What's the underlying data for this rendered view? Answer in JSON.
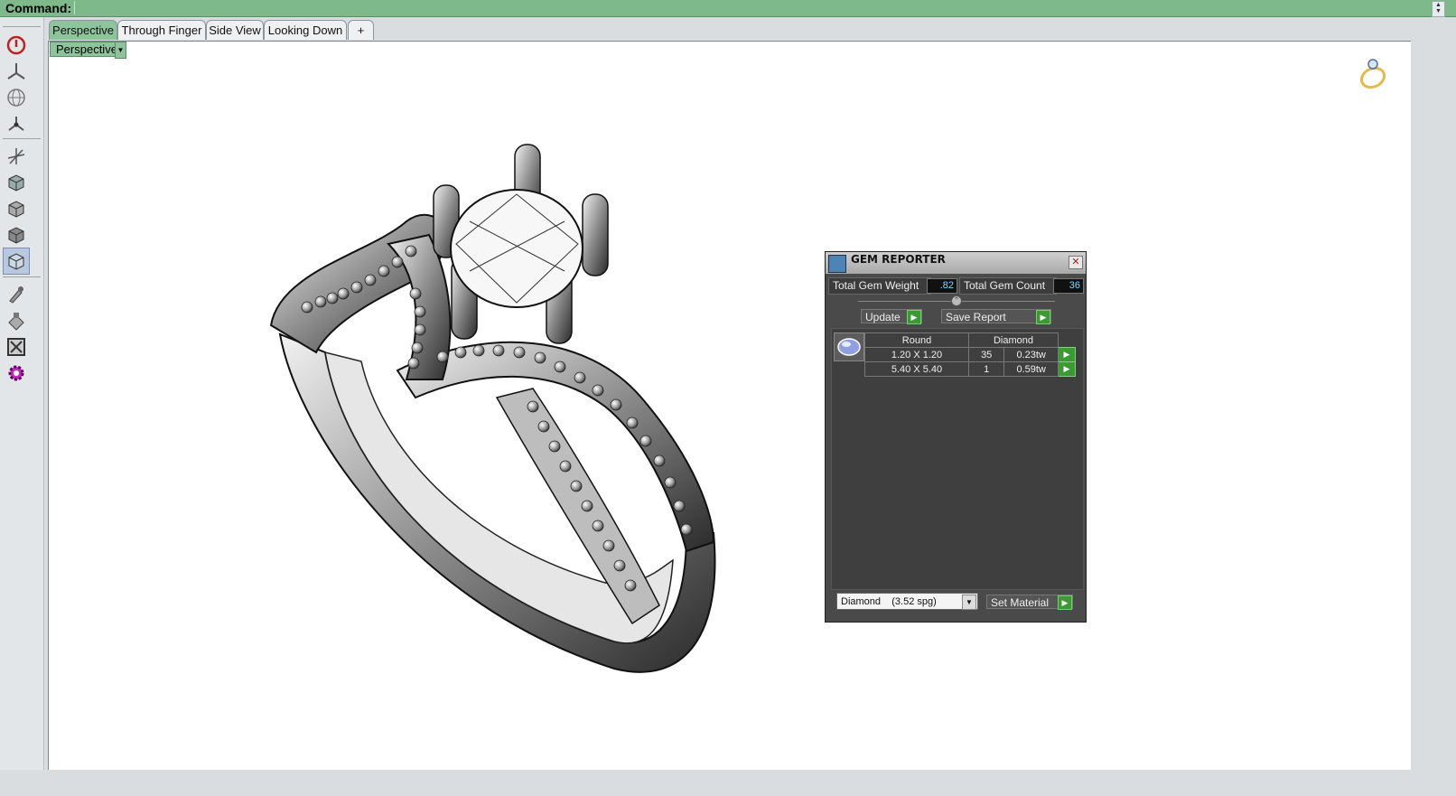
{
  "command_bar": {
    "label": "Command:",
    "value": ""
  },
  "tabs": [
    {
      "label": "Perspective"
    },
    {
      "label": "Through Finger"
    },
    {
      "label": "Side View"
    },
    {
      "label": "Looking Down"
    },
    {
      "label": "+"
    }
  ],
  "viewport": {
    "label": "Perspective"
  },
  "toolbar": {
    "icons": [
      "power-icon",
      "axes-icon",
      "sphere-icon",
      "node-icon",
      "move-icon",
      "cube-icon",
      "cube-icon",
      "cube-icon",
      "cube-icon",
      "brush-icon",
      "paint-icon",
      "frame-icon",
      "gear-icon"
    ]
  },
  "gem_reporter": {
    "title": "GEM REPORTER",
    "total_weight_label": "Total Gem Weight",
    "total_weight_value": ".82",
    "total_count_label": "Total Gem Count",
    "total_count_value": "36",
    "update_label": "Update",
    "save_label": "Save Report",
    "table": {
      "headers": [
        "Round",
        "Diamond"
      ],
      "rows": [
        {
          "size": "1.20 X 1.20",
          "count": "35",
          "weight": "0.23tw"
        },
        {
          "size": "5.40 X 5.40",
          "count": "1",
          "weight": "0.59tw"
        }
      ]
    },
    "material_select": "Diamond    (3.52 spg)",
    "set_material_label": "Set Material"
  }
}
